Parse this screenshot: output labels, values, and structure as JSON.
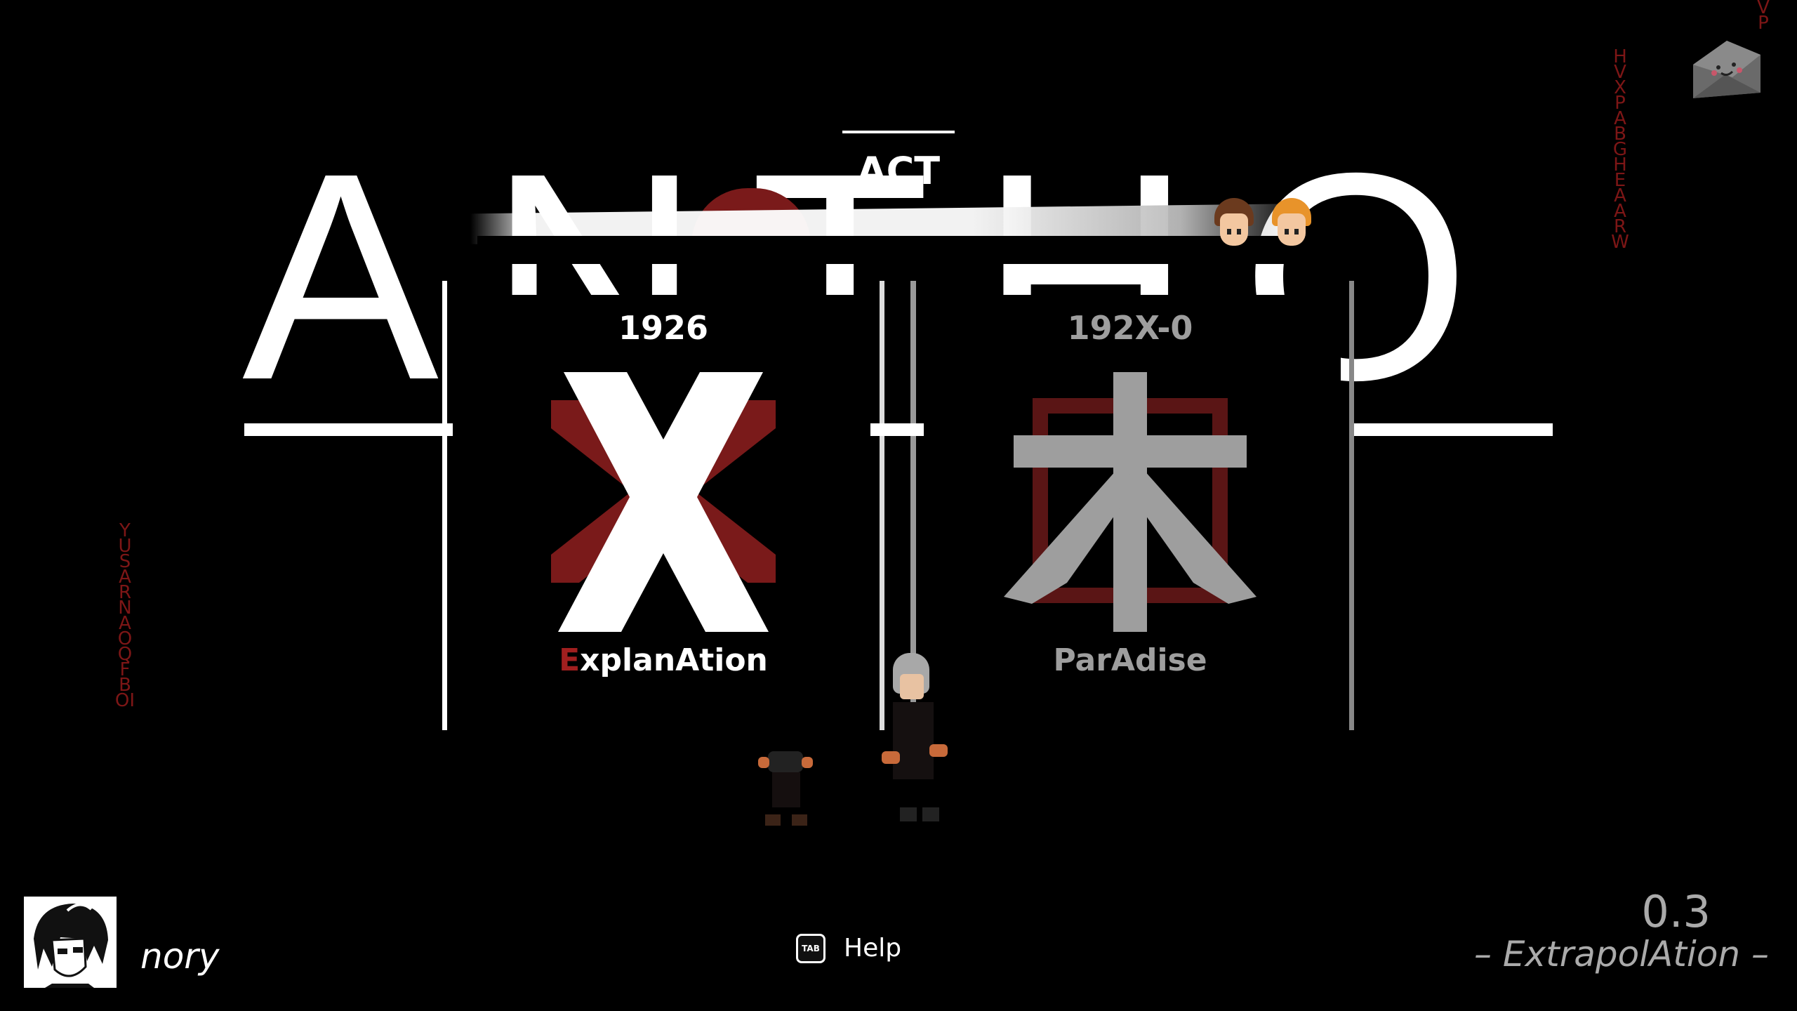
{
  "background_title": "ANTHOLOGY",
  "header": {
    "section_label": "ACT"
  },
  "side_text": {
    "left": "YUSARNAOQFBOI",
    "right": "HVXPABGHEAARW",
    "top_right": "VP"
  },
  "acts": [
    {
      "year": "1926",
      "name_first": "E",
      "name_rest": "xplanAtion",
      "icon": "x-emblem-icon",
      "accent": "#a11f1f"
    },
    {
      "year": "192X-0",
      "name": "ParAdise",
      "icon": "paradise-kanji-icon",
      "kanji": "木",
      "accent": "#6e1a1a"
    }
  ],
  "player": {
    "name": "nory",
    "avatar": "player-avatar"
  },
  "help": {
    "key": "TAB",
    "label": "Help"
  },
  "version": {
    "number": "0.3",
    "name": "– ExtrapolAtion –"
  },
  "colors": {
    "background": "#000000",
    "accent_red": "#a11f1f",
    "muted": "#9e9e9e"
  }
}
